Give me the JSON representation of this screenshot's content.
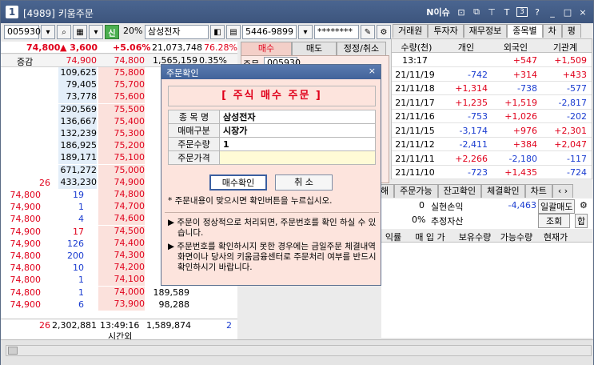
{
  "window": {
    "number": "1",
    "title": "[4989] 키움주문",
    "right_label": "N이슈",
    "buttons": [
      "⊡",
      "⧉",
      "⊤",
      "T",
      "3",
      "?",
      "_",
      "□",
      "×"
    ]
  },
  "left": {
    "code": "005930",
    "margin": "20%",
    "stock_name": "삼성전자",
    "price": "74,800",
    "change": "▲ 3,600",
    "rate": "+5.06%",
    "volume": "21,073,748",
    "volume_rate": "76.28%",
    "row2": {
      "label": "증감",
      "p1": "74,900",
      "p2": "74,800",
      "v": "1,565,159",
      "pct": "0.35%"
    },
    "asks": [
      {
        "qty": "109,625",
        "price": "75,800"
      },
      {
        "qty": "79,405",
        "price": "75,700"
      },
      {
        "qty": "73,778",
        "price": "75,600"
      },
      {
        "qty": "290,569",
        "price": "75,500"
      },
      {
        "qty": "136,667",
        "price": "75,400"
      },
      {
        "qty": "132,239",
        "price": "75,300"
      },
      {
        "qty": "186,925",
        "price": "75,200"
      },
      {
        "qty": "189,171",
        "price": "75,100"
      },
      {
        "qty": "671,272",
        "price": "75,000"
      },
      {
        "cnt": "26",
        "qty": "433,230",
        "price": "74,900"
      }
    ],
    "trades": [
      {
        "p": "74,800",
        "q": "19",
        "price": "74,800"
      },
      {
        "p": "74,900",
        "q": "1",
        "price": "74,700"
      },
      {
        "p": "74,800",
        "q": "4",
        "price": "74,600"
      },
      {
        "p": "74,900",
        "q": "17",
        "price": "74,500"
      },
      {
        "p": "74,900",
        "q": "126",
        "price": "74,400"
      },
      {
        "p": "74,800",
        "q": "200",
        "price": "74,300"
      },
      {
        "p": "74,800",
        "q": "10",
        "price": "74,200"
      },
      {
        "p": "74,800",
        "q": "1",
        "price": "74,100"
      },
      {
        "p": "74,800",
        "q": "1",
        "price": "74,000"
      },
      {
        "p": "74,900",
        "q": "6",
        "price": "73,900"
      }
    ],
    "bids": [
      "",
      "",
      "",
      "",
      "",
      "",
      "",
      "",
      "189,589",
      "98,288"
    ],
    "bid_first": "2",
    "footer": {
      "cnt": "26",
      "ask_total": "2,302,881",
      "time": "13:49:16",
      "bid_total": "1,589,874",
      "right": "2",
      "label": "시간외"
    }
  },
  "order": {
    "account": "5446-9899",
    "password": "********",
    "tabs": [
      "매수",
      "매도",
      "정정/취소"
    ],
    "code": "005930",
    "stock": "삼성전자"
  },
  "investor": {
    "tabs": [
      "거래원",
      "투자자",
      "재무정보",
      "종목별",
      "차",
      "평"
    ],
    "headers": [
      "수량(천)",
      "개인",
      "외국인",
      "기관계"
    ],
    "rows": [
      {
        "d": "13:17",
        "a": "",
        "b": "+547",
        "c": "+1,509"
      },
      {
        "d": "21/11/19",
        "a": "-742",
        "b": "+314",
        "c": "+433"
      },
      {
        "d": "21/11/18",
        "a": "+1,314",
        "b": "-738",
        "c": "-577"
      },
      {
        "d": "21/11/17",
        "a": "+1,235",
        "b": "+1,519",
        "c": "-2,817"
      },
      {
        "d": "21/11/16",
        "a": "-753",
        "b": "+1,026",
        "c": "-202"
      },
      {
        "d": "21/11/15",
        "a": "-3,174",
        "b": "+976",
        "c": "+2,301"
      },
      {
        "d": "21/11/12",
        "a": "-2,411",
        "b": "+384",
        "c": "+2,047"
      },
      {
        "d": "21/11/11",
        "a": "+2,266",
        "c": "-117",
        "b": "-2,180"
      },
      {
        "d": "21/11/10",
        "a": "-723",
        "b": "+1,435",
        "c": "-724"
      }
    ]
  },
  "balance": {
    "tabs": [
      "해",
      "주문가능",
      "잔고확인",
      "체결확인",
      "차트"
    ],
    "r1": {
      "v": "0",
      "label": "실현손익",
      "amt": "-4,463",
      "btn": "일괄매도"
    },
    "r2": {
      "v": "0%",
      "label": "추정자산",
      "btn": "조회",
      "btn2": "합"
    },
    "headers": [
      "익률",
      "매 입 가",
      "보유수량",
      "가능수량",
      "현재가"
    ]
  },
  "dialog": {
    "title": "주문확인",
    "close": "×",
    "heading": "[ 주식 매수 주문 ]",
    "fields": [
      {
        "label": "종 목 명",
        "value": "삼성전자"
      },
      {
        "label": "매매구분",
        "value": "시장가"
      },
      {
        "label": "주문수량",
        "value": "1"
      },
      {
        "label": "주문가격",
        "value": ""
      }
    ],
    "confirm": "매수확인",
    "cancel": "취  소",
    "note": "* 주문내용이 맞으시면 확인버튼을 누르십시오.",
    "msg1": "▶ 주문이 정상적으로 처리되면, 주문번호를 확인 하실 수 있습니다.",
    "msg2": "▶ 주문번호를 확인하시지 못한 경우에는 금일주문 체결내역 화면이나 당사의 키움금융센터로 주문처리 여부를 반드시 확인하시기 바랍니다."
  }
}
